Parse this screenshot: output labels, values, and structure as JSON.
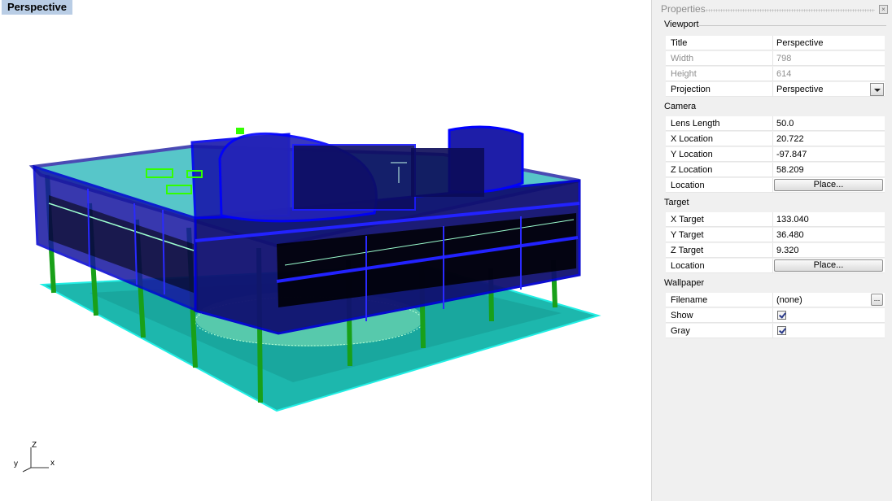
{
  "viewport": {
    "title": "Perspective",
    "axes": {
      "z": "Z",
      "y": "y",
      "x": "x"
    }
  },
  "properties": {
    "title": "Properties",
    "close_icon": "close-icon",
    "sections": {
      "viewport": {
        "label": "Viewport",
        "title_label": "Title",
        "title_value": "Perspective",
        "width_label": "Width",
        "width_value": "798",
        "height_label": "Height",
        "height_value": "614",
        "projection_label": "Projection",
        "projection_value": "Perspective"
      },
      "camera": {
        "label": "Camera",
        "lens_label": "Lens Length",
        "lens_value": "50.0",
        "x_label": "X Location",
        "x_value": "20.722",
        "y_label": "Y Location",
        "y_value": "-97.847",
        "z_label": "Z Location",
        "z_value": "58.209",
        "location_label": "Location",
        "place_button": "Place..."
      },
      "target": {
        "label": "Target",
        "x_label": "X Target",
        "x_value": "133.040",
        "y_label": "Y Target",
        "y_value": "36.480",
        "z_label": "Z Target",
        "z_value": "9.320",
        "location_label": "Location",
        "place_button": "Place..."
      },
      "wallpaper": {
        "label": "Wallpaper",
        "filename_label": "Filename",
        "filename_value": "(none)",
        "browse_button": "...",
        "show_label": "Show",
        "show_checked": true,
        "gray_label": "Gray",
        "gray_checked": true
      }
    }
  },
  "colors": {
    "viewport_title_bg": "#b9cde5",
    "model_blue": "#1a1aa8",
    "glass_cyan": "#19c9c0",
    "column_green": "#1a9a1a",
    "accent_green": "#33ff00"
  }
}
